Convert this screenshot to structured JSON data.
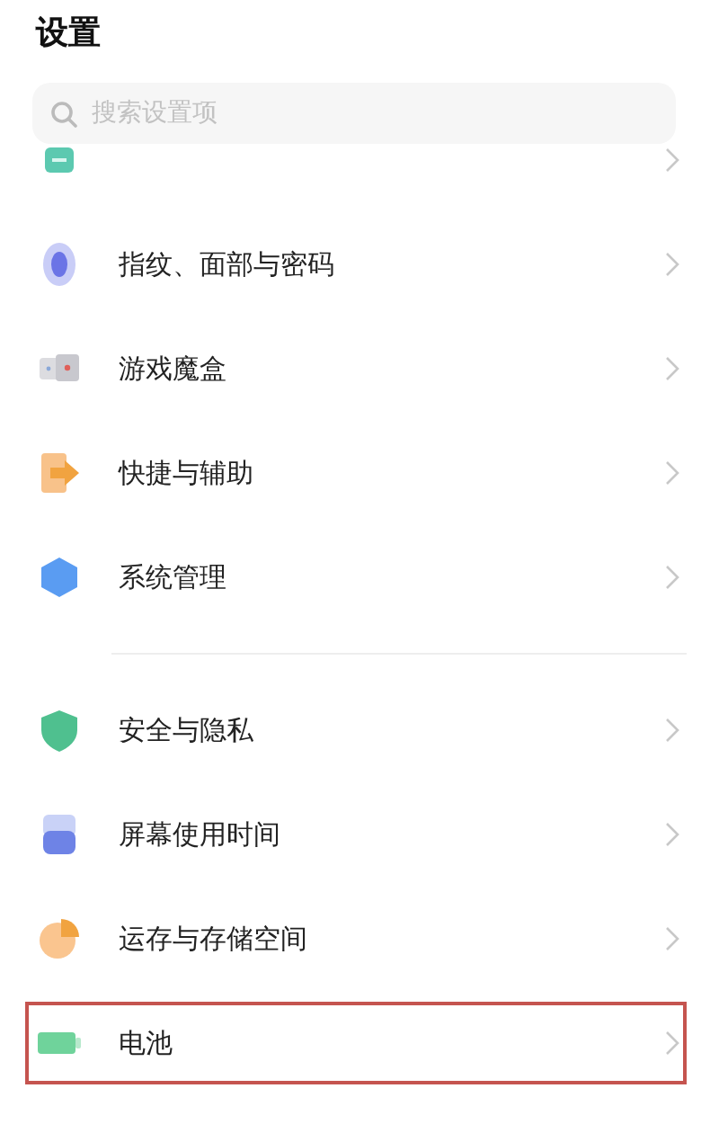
{
  "title": "设置",
  "search": {
    "placeholder": "搜索设置项"
  },
  "groups": [
    {
      "items": [
        {
          "label": "指纹、面部与密码",
          "highlighted": false
        },
        {
          "label": "游戏魔盒",
          "highlighted": false
        },
        {
          "label": "快捷与辅助",
          "highlighted": false
        },
        {
          "label": "系统管理",
          "highlighted": false
        }
      ]
    },
    {
      "items": [
        {
          "label": "安全与隐私",
          "highlighted": false
        },
        {
          "label": "屏幕使用时间",
          "highlighted": false
        },
        {
          "label": "运存与存储空间",
          "highlighted": false
        },
        {
          "label": "电池",
          "highlighted": true
        }
      ]
    }
  ]
}
